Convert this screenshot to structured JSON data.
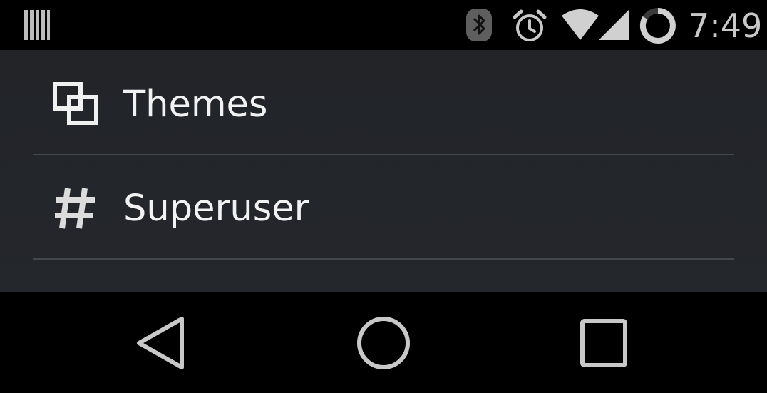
{
  "status_bar": {
    "time": "7:49",
    "icons": [
      "notification-icon",
      "bluetooth-icon",
      "alarm-icon",
      "wifi-icon",
      "cell-signal-icon",
      "battery-icon"
    ],
    "icon_color": "#c8c8c8"
  },
  "menu": {
    "items": [
      {
        "label": "Themes",
        "icon": "themes-icon"
      },
      {
        "label": "Superuser",
        "icon": "hash-icon"
      }
    ]
  },
  "nav_bar": {
    "buttons": [
      "back-icon",
      "home-icon",
      "recents-icon"
    ],
    "icon_color": "#c8c8c8"
  },
  "colors": {
    "background": "#222428",
    "divider": "#44474c",
    "text": "#f2f2f2"
  }
}
